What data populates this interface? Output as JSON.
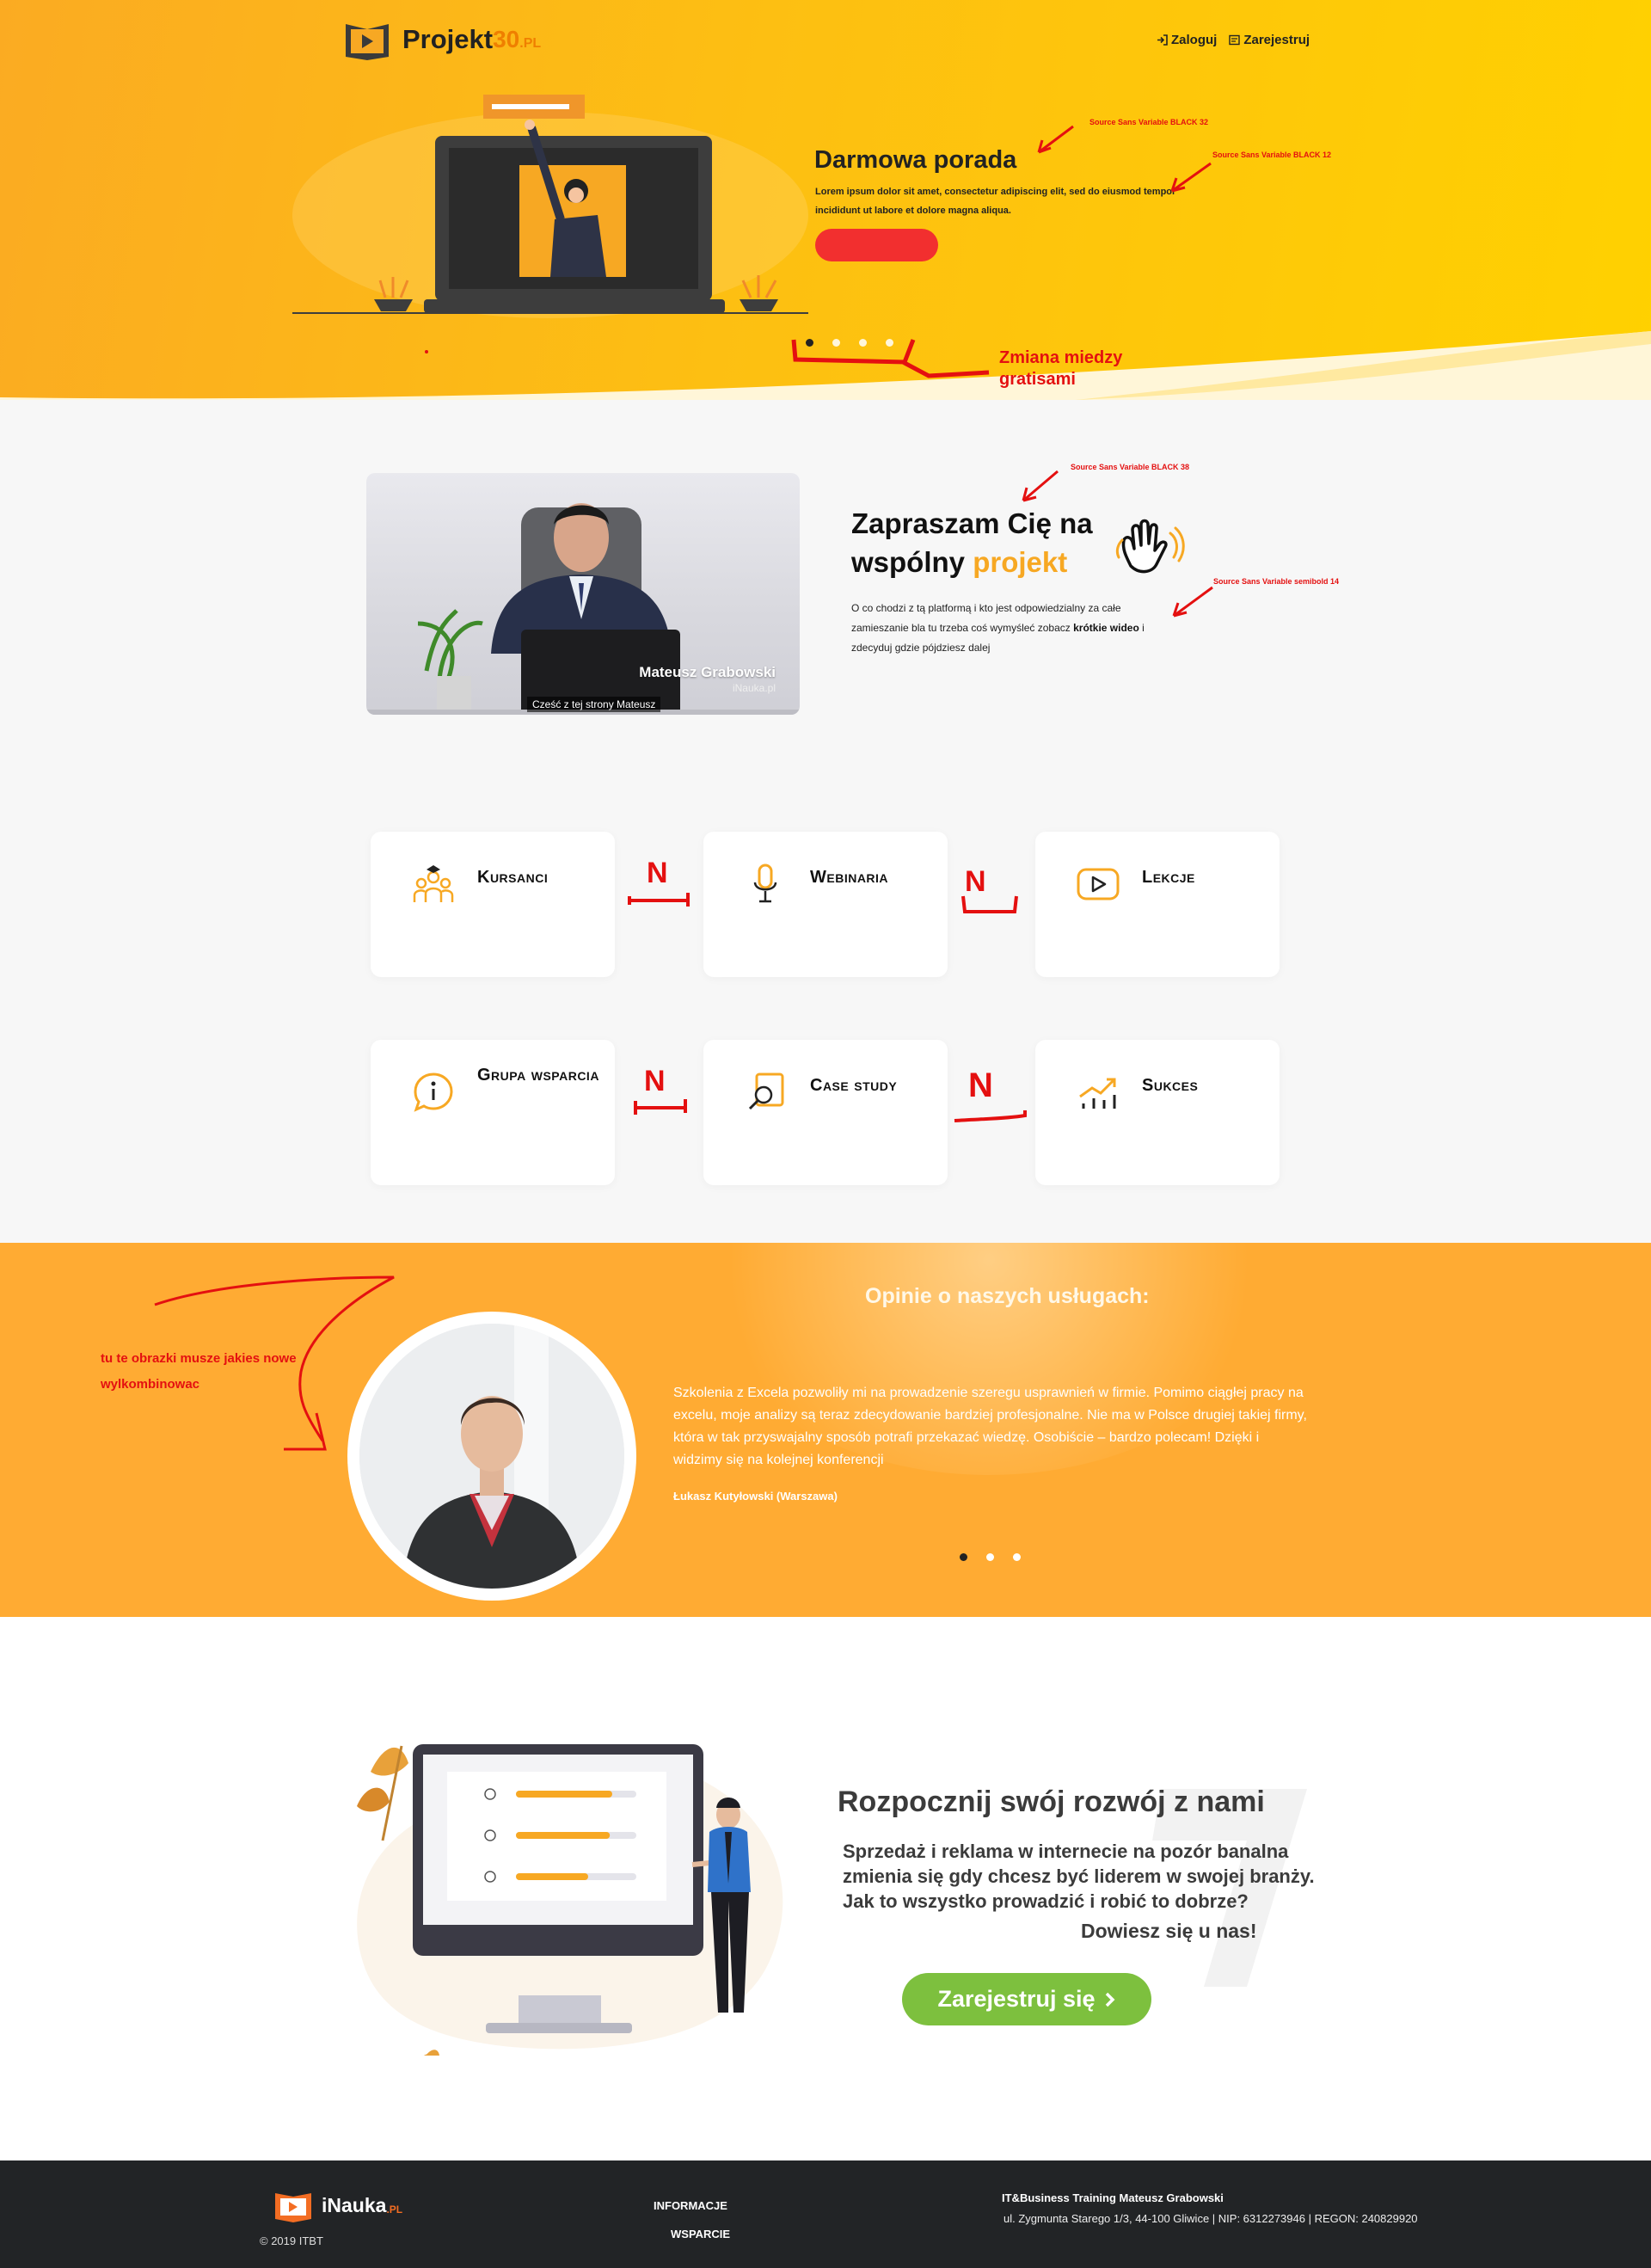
{
  "header": {
    "logo_text": "Projekt",
    "logo_number": "30",
    "logo_suffix": ".PL",
    "login": "Zaloguj",
    "register": "Zarejestruj"
  },
  "hero": {
    "title": "Darmowa porada",
    "text": "Lorem ipsum dolor sit amet, consectetur adipiscing elit, sed do eiusmod tempor incididunt ut labore et dolore magna aliqua.",
    "button_label": "",
    "slides": 4,
    "active_slide": 1
  },
  "annotations": {
    "font_title": "Source Sans Variable BLACK 32",
    "font_text": "Source Sans Variable BLACK 12",
    "slider_note_1": "Zmiana miedzy",
    "slider_note_2": "gratisami",
    "font_intro_title": "Source Sans Variable BLACK 38",
    "font_intro_text": "Source Sans Variable semibold 14",
    "testimonial_note_1": "tu te obrazki musze jakies nowe",
    "testimonial_note_2": "wylkombinowac",
    "arrow_mark": "N"
  },
  "intro": {
    "video_name": "Mateusz Grabowski",
    "video_site": "iNauka.pl",
    "video_subtitle": "Cześć z tej strony Mateusz",
    "title_line1": "Zapraszam Cię na",
    "title_line2_a": "wspólny ",
    "title_line2_b": "projekt",
    "text_a": "O co chodzi z tą platformą i kto jest odpowiedzialny za całe zamieszanie bla tu trzeba coś wymyśleć zobacz ",
    "text_bold": "krótkie wideo",
    "text_b": " i zdecyduj gdzie pójdziesz dalej"
  },
  "features": [
    {
      "label": "Kursanci",
      "icon": "students-icon"
    },
    {
      "label": "Webinaria",
      "icon": "microphone-icon"
    },
    {
      "label": "Lekcje",
      "icon": "play-icon"
    },
    {
      "label": "Grupa wsparcia",
      "icon": "info-bubble-icon"
    },
    {
      "label": "Case study",
      "icon": "search-doc-icon"
    },
    {
      "label": "Sukces",
      "icon": "growth-chart-icon"
    }
  ],
  "testimonials": {
    "title": "Opinie o naszych usługach:",
    "quote": "Szkolenia z Excela pozwoliły mi na prowadzenie szeregu usprawnień w firmie. Pomimo ciągłej pracy na excelu, moje analizy są teraz zdecydowanie bardziej profesjonalne. Nie ma w Polsce drugiej takiej firmy, która w tak przyswajalny sposób potrafi przekazać wiedzę. Osobiście – bardzo polecam! Dzięki i widzimy się na kolejnej konferencji",
    "author": "Łukasz Kutyłowski (Warszawa)",
    "slides": 3,
    "active_slide": 1
  },
  "cta": {
    "title": "Rozpocznij swój rozwój z nami",
    "text": "Sprzedaż i reklama w internecie na pozór banalna zmienia się gdy chcesz być liderem w swojej branży. Jak to wszystko prowadzić i robić to dobrze?",
    "strong": "Dowiesz się u nas!",
    "button": "Zarejestruj się",
    "chart_progress": [
      0.8,
      0.78,
      0.6
    ],
    "colors": {
      "button": "#7dc03e",
      "accent": "#f7a823"
    }
  },
  "footer": {
    "logo": "iNauka",
    "logo_suffix": ".PL",
    "copyright": "© 2019 ITBT",
    "link_1": "INFORMACJE",
    "link_2": "WSPARCIE",
    "company": "IT&Business Training Mateusz Grabowski",
    "address": "ul. Zygmunta Starego 1/3, 44-100 Gliwice | NIP: 6312273946 | REGON: 240829920"
  }
}
